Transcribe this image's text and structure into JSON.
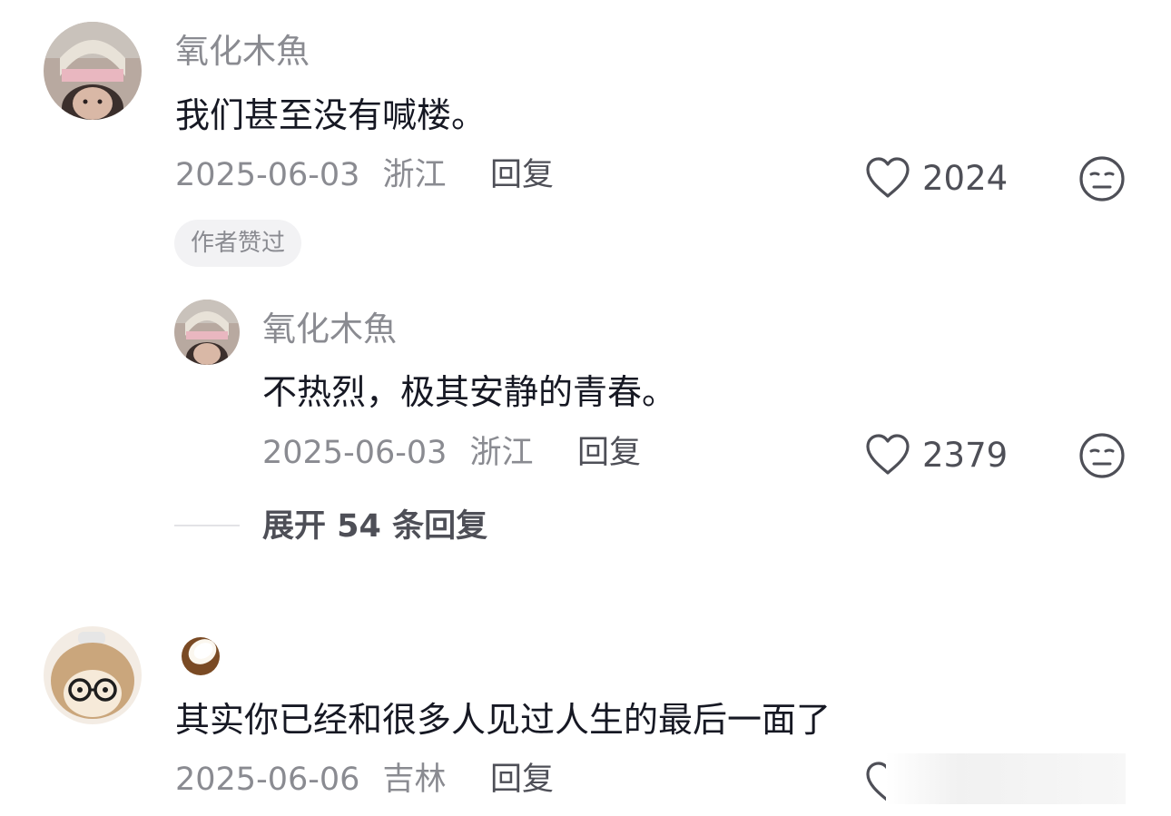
{
  "comments": [
    {
      "username": "氧化木魚",
      "text": "我们甚至没有喊楼。",
      "date": "2025-06-03",
      "location": "浙江",
      "reply_label": "回复",
      "likes": "2024",
      "badge": "作者赞过",
      "icons": {
        "like": "heart-outline-icon",
        "dislike": "unamused-face-icon"
      },
      "replies": [
        {
          "username": "氧化木魚",
          "text": "不热烈，极其安静的青春。",
          "date": "2025-06-03",
          "location": "浙江",
          "reply_label": "回复",
          "likes": "2379"
        }
      ],
      "expand_label": "展开 54 条回复"
    },
    {
      "username_icon": "coconut-emoji",
      "text": "其实你已经和很多人见过人生的最后一面了",
      "date": "2025-06-06",
      "location": "吉林",
      "reply_label": "回复"
    }
  ],
  "colors": {
    "primary_text": "#161823",
    "secondary_text": "#8a8b91",
    "badge_bg": "#f2f2f4"
  }
}
